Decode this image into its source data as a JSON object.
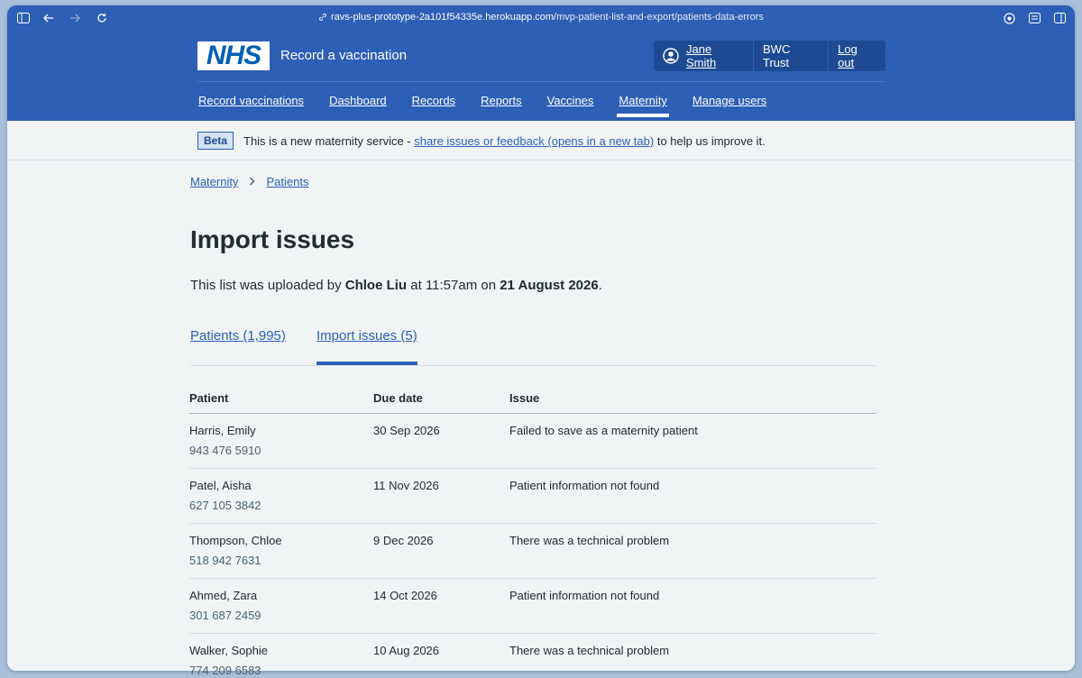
{
  "browser": {
    "url_host": "ravs-plus-prototype-2a101f54335e.herokuapp.com",
    "url_path": "/mvp-patient-list-and-export/patients-data-errors"
  },
  "header": {
    "logo_text": "NHS",
    "service_name": "Record a vaccination",
    "account": {
      "user_name": "Jane Smith",
      "organisation": "BWC Trust",
      "logout_label": "Log out"
    },
    "nav": [
      {
        "label": "Record vaccinations",
        "active": false
      },
      {
        "label": "Dashboard",
        "active": false
      },
      {
        "label": "Records",
        "active": false
      },
      {
        "label": "Reports",
        "active": false
      },
      {
        "label": "Vaccines",
        "active": false
      },
      {
        "label": "Maternity",
        "active": true
      },
      {
        "label": "Manage users",
        "active": false
      }
    ]
  },
  "phase_banner": {
    "tag": "Beta",
    "text_before": "This is a new maternity service - ",
    "link_text": "share issues or feedback (opens in a new tab)",
    "text_after": " to help us improve it."
  },
  "breadcrumb": [
    {
      "label": "Maternity"
    },
    {
      "label": "Patients"
    }
  ],
  "page": {
    "title": "Import issues",
    "lead_prefix": "This list was uploaded by ",
    "uploaded_by": "Chloe Liu",
    "lead_mid": " at 11:57am on ",
    "upload_date": "21 August 2026",
    "lead_suffix": "."
  },
  "tabs": [
    {
      "label": "Patients (1,995)",
      "selected": false
    },
    {
      "label": "Import issues (5)",
      "selected": true
    }
  ],
  "table": {
    "headers": [
      "Patient",
      "Due date",
      "Issue"
    ],
    "rows": [
      {
        "name": "Harris, Emily",
        "nhs_number": "943 476 5910",
        "due_date": "30 Sep 2026",
        "issue": "Failed to save as a maternity patient"
      },
      {
        "name": "Patel, Aisha",
        "nhs_number": "627 105 3842",
        "due_date": "11 Nov 2026",
        "issue": "Patient information not found"
      },
      {
        "name": "Thompson, Chloe",
        "nhs_number": "518 942 7631",
        "due_date": "9 Dec 2026",
        "issue": "There was a technical problem"
      },
      {
        "name": "Ahmed, Zara",
        "nhs_number": "301 687 2459",
        "due_date": "14 Oct 2026",
        "issue": "Patient information not found"
      },
      {
        "name": "Walker, Sophie",
        "nhs_number": "774 209 6583",
        "due_date": "10 Aug 2026",
        "issue": "There was a technical problem"
      }
    ]
  }
}
